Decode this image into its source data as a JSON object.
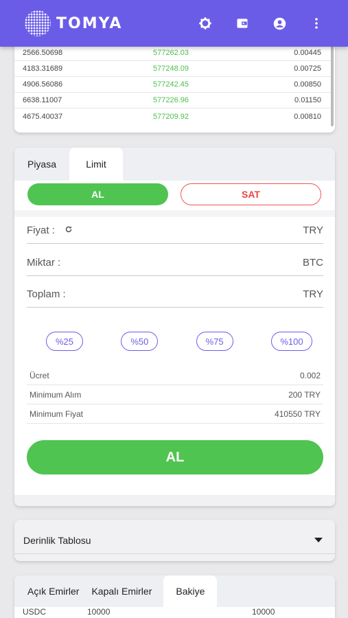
{
  "brand": {
    "name": "TOMYA",
    "accent": "#6b5ce7",
    "buy_color": "#50c451",
    "sell_color": "#e44444"
  },
  "header": {
    "icons": [
      "settings-icon",
      "wallet-icon",
      "account-icon",
      "more-vert-icon"
    ]
  },
  "trades": {
    "rows": [
      {
        "amount": "2566.50698",
        "price": "577262.03",
        "total": "0.00445"
      },
      {
        "amount": "4183.31689",
        "price": "577248.09",
        "total": "0.00725"
      },
      {
        "amount": "4906.56086",
        "price": "577242.45",
        "total": "0.00850"
      },
      {
        "amount": "6638.11007",
        "price": "577226.96",
        "total": "0.01150"
      },
      {
        "amount": "4675.40037",
        "price": "577209.92",
        "total": "0.00810"
      }
    ]
  },
  "order": {
    "tabs": {
      "market": "Piyasa",
      "limit": "Limit"
    },
    "buy_label": "AL",
    "sell_label": "SAT",
    "fields": {
      "price": {
        "label": "Fiyat :",
        "unit": "TRY"
      },
      "amount": {
        "label": "Miktar :",
        "unit": "BTC"
      },
      "total": {
        "label": "Toplam :",
        "unit": "TRY"
      }
    },
    "percents": [
      "%25",
      "%50",
      "%75",
      "%100"
    ],
    "info": {
      "fee_label": "Ücret",
      "fee_value": "0.002",
      "min_buy_label": "Minimum Alım",
      "min_buy_value": "200 TRY",
      "min_price_label": "Minimum Fiyat",
      "min_price_value": "410550 TRY"
    },
    "submit_label": "AL"
  },
  "depth": {
    "title": "Derinlik Tablosu"
  },
  "bottom": {
    "tabs": {
      "open": "Açık Emirler",
      "closed": "Kapalı Emirler",
      "balance": "Bakiye"
    },
    "row": {
      "asset": "USDC",
      "available": "10000",
      "total": "10000"
    }
  }
}
